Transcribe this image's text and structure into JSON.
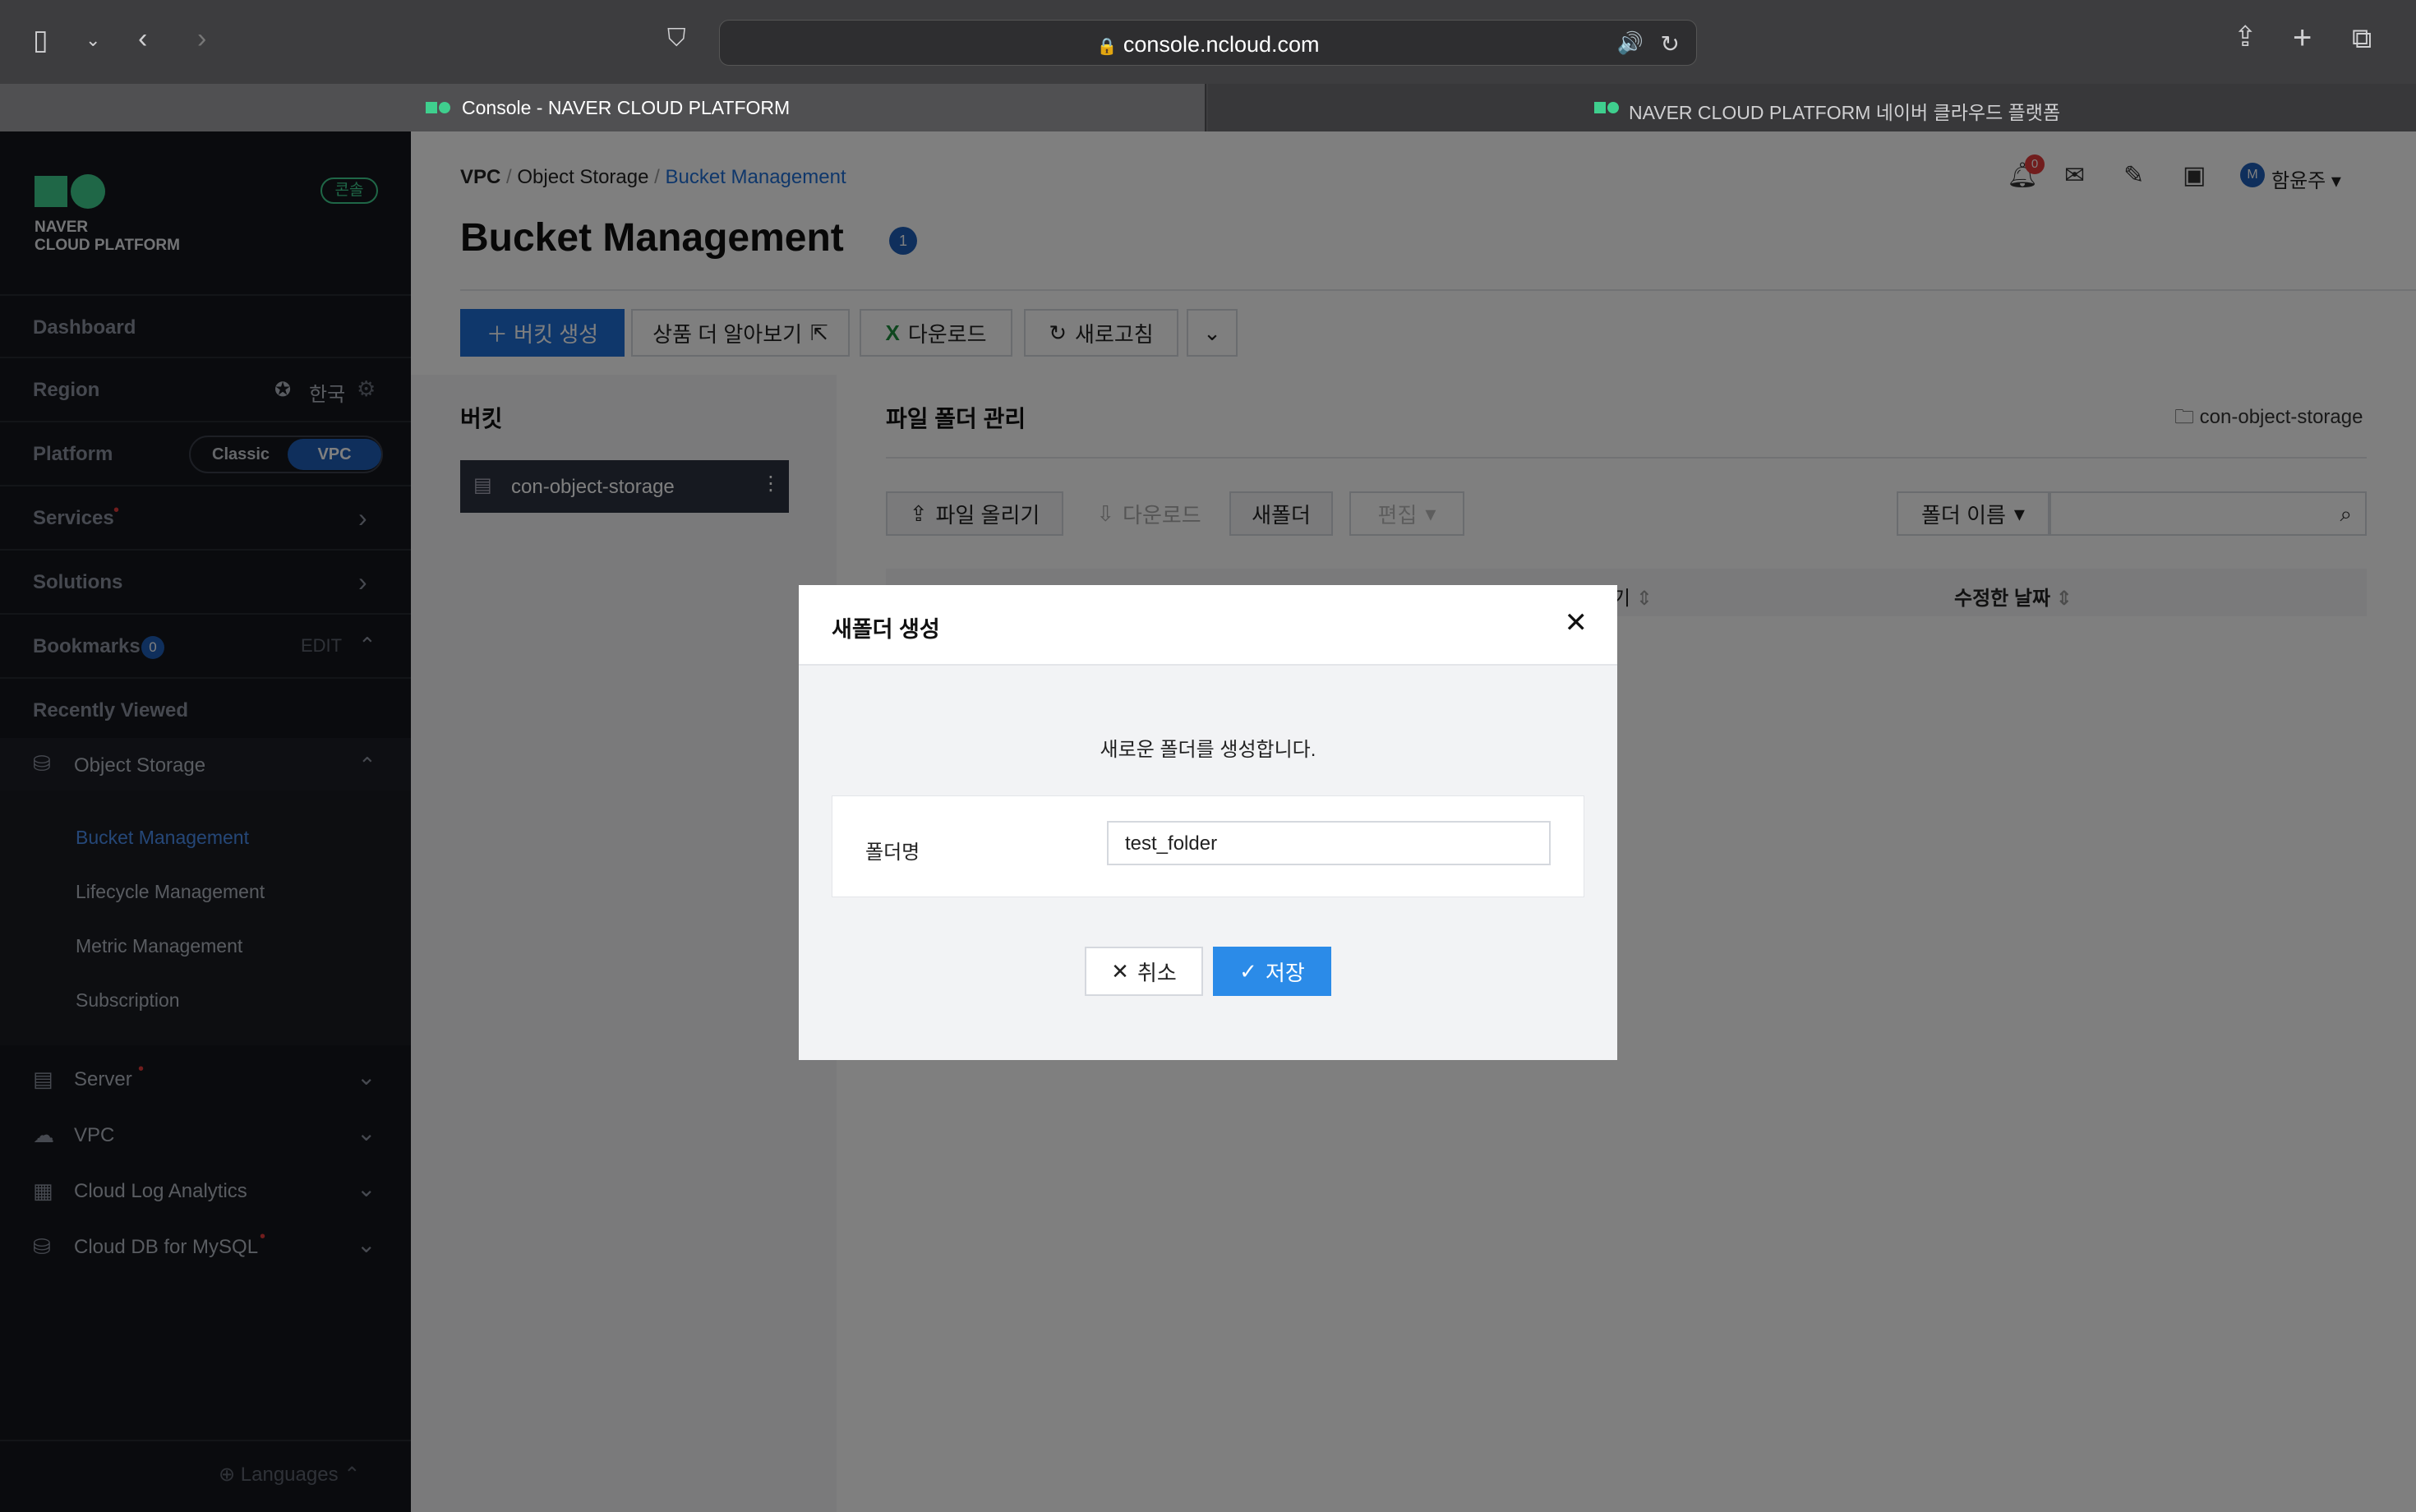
{
  "browser": {
    "url": "console.ncloud.com",
    "tabs": [
      {
        "title": "Console - NAVER CLOUD PLATFORM"
      },
      {
        "title": "NAVER CLOUD PLATFORM 네이버 클라우드 플랫폼"
      }
    ]
  },
  "sidebar": {
    "logo_line1": "NAVER",
    "logo_line2": "CLOUD PLATFORM",
    "console_badge": "콘솔",
    "dashboard": "Dashboard",
    "region_label": "Region",
    "region_value": "한국",
    "platform_label": "Platform",
    "platform_classic": "Classic",
    "platform_vpc": "VPC",
    "services": "Services",
    "solutions": "Solutions",
    "bookmarks": "Bookmarks",
    "bookmarks_count": "0",
    "bookmarks_edit": "EDIT",
    "recently_viewed": "Recently Viewed",
    "object_storage": "Object Storage",
    "sub_items": [
      "Bucket Management",
      "Lifecycle Management",
      "Metric Management",
      "Subscription"
    ],
    "server": "Server",
    "vpc": "VPC",
    "cloud_log": "Cloud Log Analytics",
    "cloud_db": "Cloud DB for MySQL",
    "languages": "Languages"
  },
  "header": {
    "breadcrumb": [
      "VPC",
      "Object Storage",
      "Bucket Management"
    ],
    "title": "Bucket Management",
    "title_badge": "1",
    "notif_count": "0",
    "user": "함윤주",
    "user_initial": "M"
  },
  "toolbar": {
    "create": "버킷 생성",
    "learn": "상품 더 알아보기",
    "download": "다운로드",
    "refresh": "새로고침"
  },
  "bucket_panel": {
    "title": "버킷",
    "bucket": "con-object-storage"
  },
  "files_panel": {
    "title": "파일 폴더 관리",
    "current": "con-object-storage",
    "upload": "파일 올리기",
    "download": "다운로드",
    "new_folder": "새폴더",
    "edit": "편집",
    "search_type": "폴더 이름",
    "col_size_partial": "기",
    "col_modified": "수정한 날짜"
  },
  "modal": {
    "title": "새폴더 생성",
    "message": "새로운 폴더를 생성합니다.",
    "field_label": "폴더명",
    "field_value": "test_folder",
    "cancel": "취소",
    "save": "저장"
  }
}
